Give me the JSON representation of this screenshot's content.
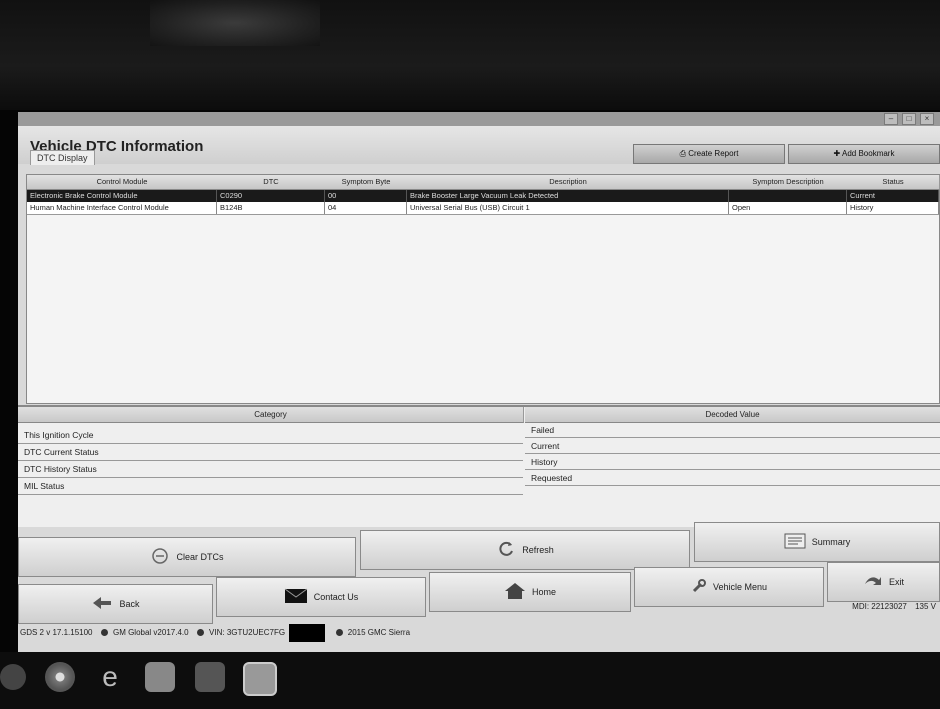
{
  "window": {
    "title": "Vehicle DTC Information",
    "tab": "DTC Display",
    "create_report_label": "Create Report",
    "add_bookmark_label": "Add Bookmark"
  },
  "dtc_table": {
    "columns": [
      "Control Module",
      "DTC",
      "Symptom Byte",
      "Description",
      "Symptom Description",
      "Status"
    ],
    "rows": [
      [
        "Electronic Brake Control Module",
        "C0290",
        "00",
        "Brake Booster Large Vacuum Leak Detected",
        "",
        "Current"
      ],
      [
        "Human Machine Interface Control Module",
        "B124B",
        "04",
        "Universal Serial Bus (USB) Circuit 1",
        "Open",
        "History"
      ]
    ]
  },
  "decode_table": {
    "category_header": "Category",
    "value_header": "Decoded Value",
    "categories": [
      "This Ignition Cycle",
      "DTC Current Status",
      "DTC History Status",
      "MIL Status"
    ],
    "values": [
      "Failed",
      "Current",
      "History",
      "Requested"
    ]
  },
  "buttons": {
    "clear_dtcs": "Clear DTCs",
    "refresh": "Refresh",
    "summary": "Summary",
    "back": "Back",
    "contact_us": "Contact Us",
    "home": "Home",
    "vehicle_menu": "Vehicle Menu",
    "exit": "Exit"
  },
  "status": {
    "version": "GDS 2 v 17.1.15100",
    "global": "GM Global v2017.4.0",
    "vin": "VIN: 3GTU2UEC7FG",
    "vehicle": "2015 GMC Sierra",
    "mdi": "MDI: 22123027",
    "mdi_extra": "135 V"
  }
}
